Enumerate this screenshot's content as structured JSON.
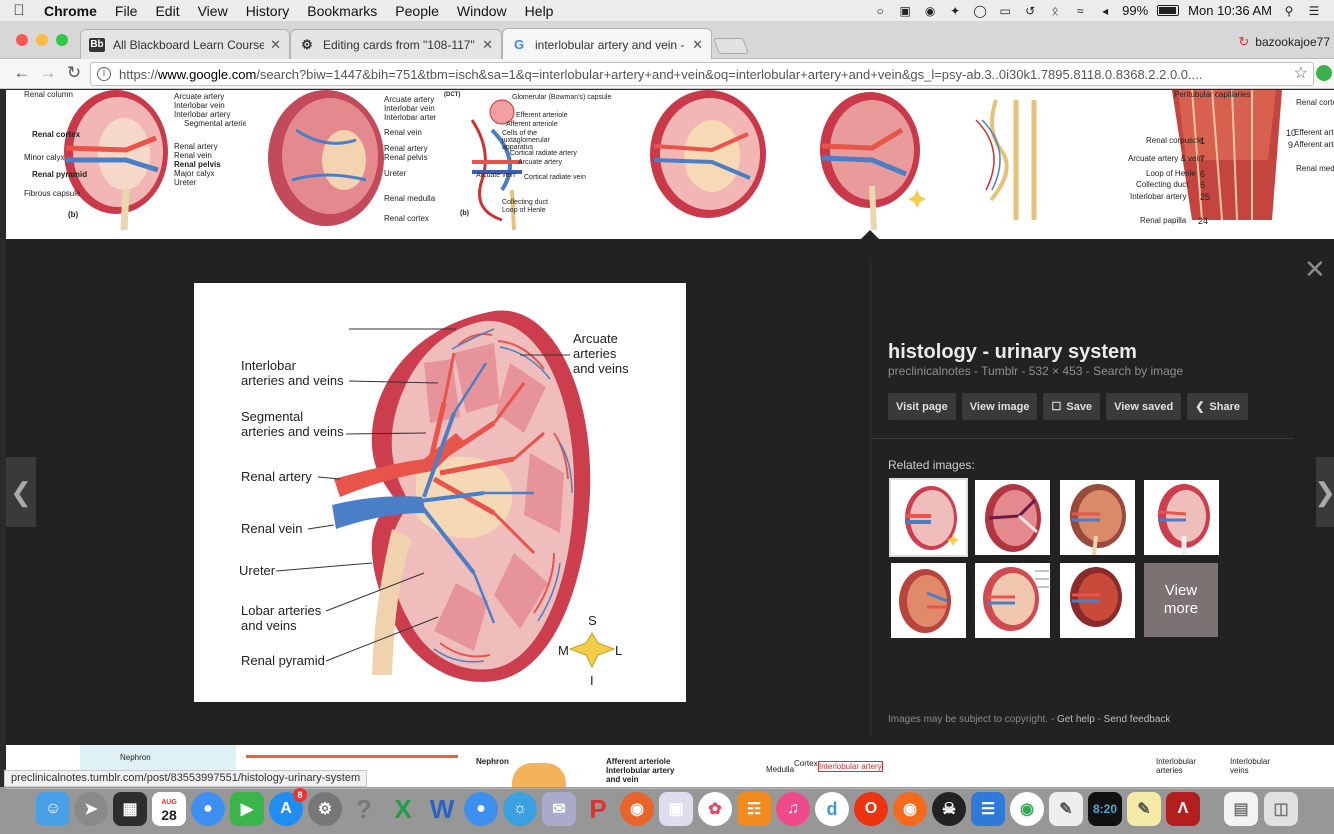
{
  "menubar": {
    "apple_icon": "apple-icon",
    "app_name": "Chrome",
    "items": [
      "File",
      "Edit",
      "View",
      "History",
      "Bookmarks",
      "People",
      "Window",
      "Help"
    ],
    "battery": "99%",
    "clock": "Mon 10:36 AM"
  },
  "tabs": [
    {
      "title": "All Blackboard Learn Courses",
      "favicon": "Bb"
    },
    {
      "title": "Editing cards from \"108-117\"",
      "favicon": "quizlet"
    },
    {
      "title": "interlobular artery and vein - G",
      "favicon": "G"
    }
  ],
  "profile": {
    "name": "bazookajoe77"
  },
  "omnibox": {
    "scheme": "https://",
    "host": "www.google.com",
    "path": "/search?biw=1447&bih=751&tbm=isch&sa=1&q=interlobular+artery+and+vein&oq=interlobular+artery+and+vein&gs_l=psy-ab.3..0i30k1.7895.8118.0.8368.2.2.0.0...."
  },
  "thumbnails_top": {
    "t1_labels": [
      "Renal column",
      "Arcuate artery",
      "Interlobar vein",
      "Interlobar artery",
      "Segmental arteries",
      "Renal cortex",
      "Renal artery",
      "Renal vein",
      "Minor calyx",
      "Renal pelvis",
      "Major calyx",
      "Renal pyramid",
      "Ureter",
      "Fibrous capsule",
      "(b)"
    ],
    "t2_labels": [
      "Arcuate artery",
      "Interlobar vein",
      "Interlobar artery",
      "Renal vein",
      "Renal artery",
      "Renal pelvis",
      "Ureter",
      "Renal medulla",
      "Renal cortex"
    ],
    "t3_labels": [
      "Glomerular (Bowman's) capsule",
      "Efferent arteriole",
      "Afferent arteriole",
      "Cells of the juxtaglomerular apparatus",
      "Cortical radiate artery",
      "Arcuate artery",
      "Arcuate vein",
      "Cortical radiate vein",
      "Collecting duct",
      "Loop of Henle",
      "(b)"
    ],
    "t7_labels": [
      "Peritubular capillaries",
      "Renal cortex",
      "Renal corpuscle",
      "Arcuate artery & vein",
      "Loop of Henle",
      "Collecting duct",
      "Interlobar artery",
      "Renal papilla",
      "Efferent arteriole",
      "Afferent arteriole",
      "Renal medulla"
    ],
    "t7_numbers": [
      "10",
      "9",
      "1",
      "7",
      "6",
      "6",
      "25",
      "24"
    ]
  },
  "main_image": {
    "labels": {
      "arcuate": "Arcuate\narteries\nand veins",
      "interlobar": "Interlobar\narteries and veins",
      "segmental": "Segmental\narteries and veins",
      "renal_artery": "Renal artery",
      "renal_vein": "Renal vein",
      "ureter": "Ureter",
      "lobar": "Lobar arteries\nand veins",
      "pyramid": "Renal pyramid"
    },
    "compass": {
      "n": "S",
      "w": "M",
      "e": "L",
      "s": "I"
    }
  },
  "details": {
    "title": "histology - urinary system",
    "meta": "preclinicalnotes - Tumblr  -  532 × 453  -  Search by image",
    "actions": [
      {
        "label": "Visit page",
        "icon": ""
      },
      {
        "label": "View image",
        "icon": ""
      },
      {
        "label": "Save",
        "icon": "bookmark-icon"
      },
      {
        "label": "View saved",
        "icon": ""
      },
      {
        "label": "Share",
        "icon": "share-icon"
      }
    ],
    "related_title": "Related images:",
    "view_more": "View\nmore",
    "footer": {
      "prefix": "Images may be subject to copyright.  -  ",
      "help": "Get help",
      "sep": "  -  ",
      "feedback": "Send feedback"
    }
  },
  "thumbnails_bottom": {
    "labels": [
      "Nephron",
      "Nephron",
      "Afferent arteriole",
      "Interlobular artery and vein",
      "Medulla",
      "Cortex",
      "Interlobular artery",
      "Interlobular arteries",
      "Interlobular veins"
    ]
  },
  "status_url": "preclinicalnotes.tumblr.com/post/83553997551/histology-urinary-system",
  "dock": {
    "calendar_month": "AUG",
    "calendar_day": "28",
    "appstore_badge": "8",
    "clock_text": "8:20"
  },
  "colors": {
    "artery": "#e8534a",
    "vein": "#4a7fc8",
    "cortex": "#f4c9c6",
    "capsule": "#c9394a",
    "panel": "#222222"
  }
}
